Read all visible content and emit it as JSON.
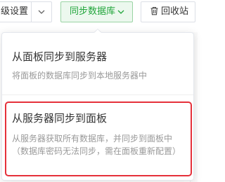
{
  "toolbar": {
    "advanced_settings_label": "级设置",
    "sync_database_label": "同步数据库",
    "recycle_bin_label": "回收站",
    "accent_color": "#20a53a",
    "icons": {
      "caret": "chevron-down-icon",
      "recycle": "trash-icon"
    }
  },
  "dropdown": {
    "items": [
      {
        "title": "从面板同步到服务器",
        "description": "将面板的数据库同步到本地服务器中"
      },
      {
        "title": "从服务器同步到面板",
        "description_line1": "从服务器获取所有数据库，并同步到面板中",
        "description_line2": "（数据库密码无法同步，需在面板重新配置）",
        "highlighted": true
      }
    ],
    "highlight_color": "#e5303a"
  }
}
